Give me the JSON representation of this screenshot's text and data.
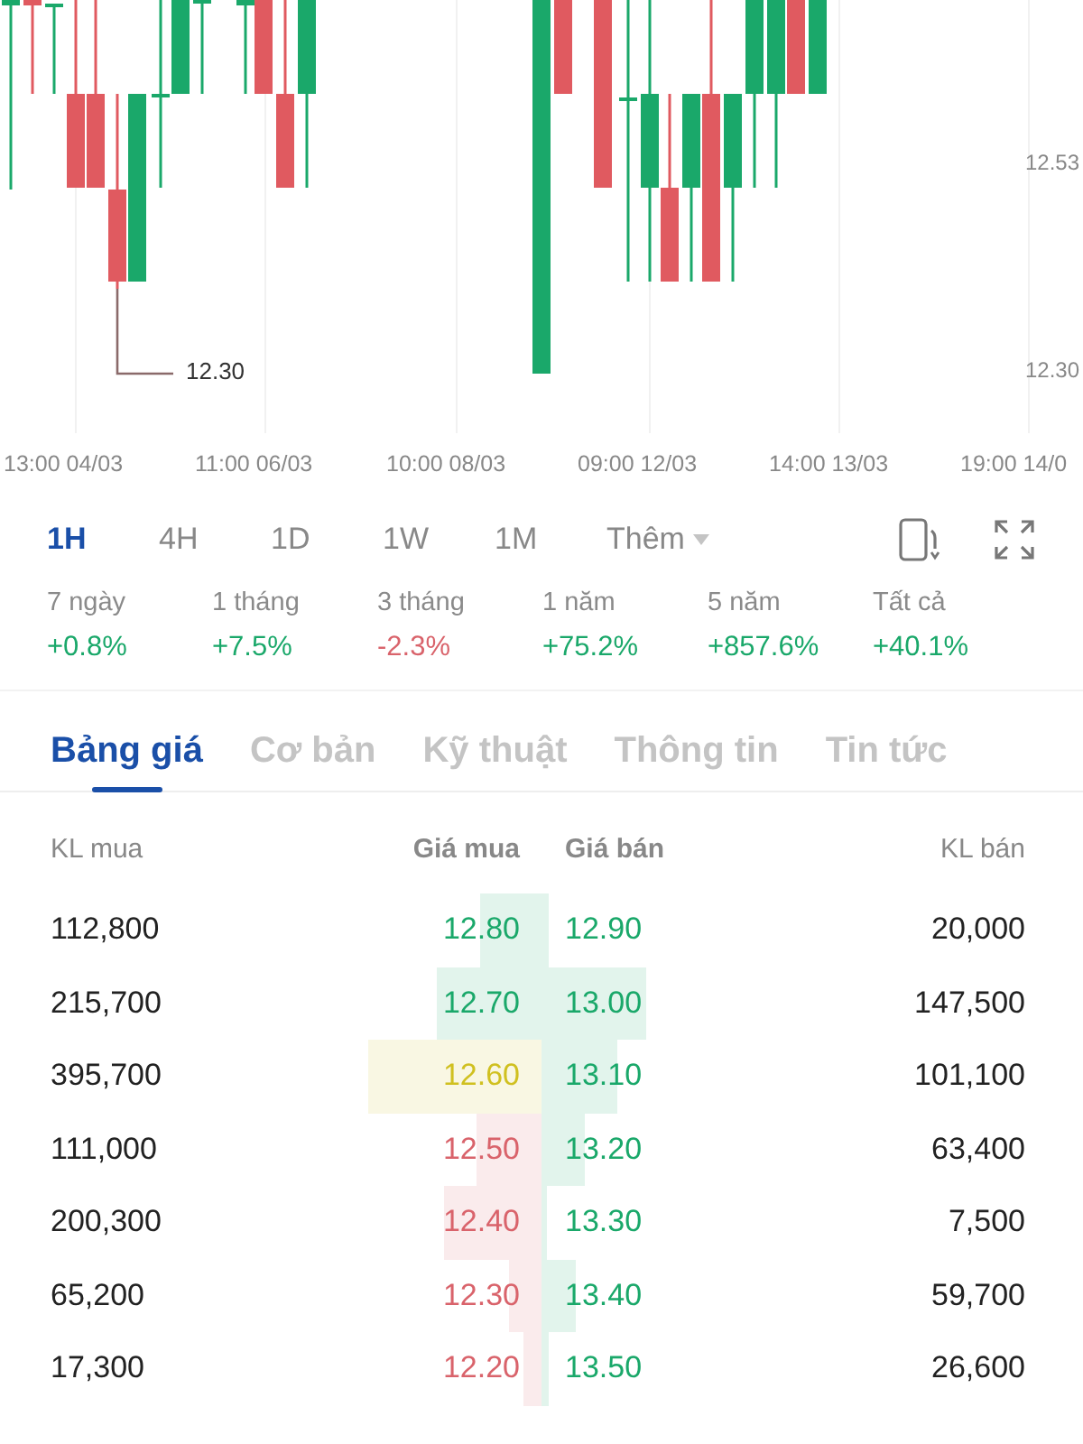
{
  "chart": {
    "y_labels": [
      "12.53",
      "12.30"
    ],
    "low_marker": "12.30",
    "x_labels": [
      "13:00 04/03",
      "11:00 06/03",
      "10:00 08/03",
      "09:00 12/03",
      "14:00 13/03",
      "19:00 14/0"
    ]
  },
  "timeframes": [
    {
      "label": "1H",
      "selected": true,
      "kind": "option"
    },
    {
      "label": "4H",
      "selected": false,
      "kind": "option"
    },
    {
      "label": "1D",
      "selected": false,
      "kind": "option"
    },
    {
      "label": "1W",
      "selected": false,
      "kind": "option"
    },
    {
      "label": "1M",
      "selected": false,
      "kind": "option"
    },
    {
      "label": "Thêm",
      "selected": false,
      "kind": "menu"
    }
  ],
  "performance": [
    {
      "label": "7 ngày",
      "value": "+0.8%",
      "color": "#1aa86a"
    },
    {
      "label": "1 tháng",
      "value": "+7.5%",
      "color": "#1aa86a"
    },
    {
      "label": "3 tháng",
      "value": "-2.3%",
      "color": "#d9636b"
    },
    {
      "label": "1 năm",
      "value": "+75.2%",
      "color": "#1aa86a"
    },
    {
      "label": "5 năm",
      "value": "+857.6%",
      "color": "#1aa86a"
    },
    {
      "label": "Tất cả",
      "value": "+40.1%",
      "color": "#1aa86a"
    }
  ],
  "tabs": [
    {
      "label": "Bảng giá",
      "selected": true
    },
    {
      "label": "Cơ bản",
      "selected": false
    },
    {
      "label": "Kỹ thuật",
      "selected": false
    },
    {
      "label": "Thông tin",
      "selected": false
    },
    {
      "label": "Tin tức",
      "selected": false
    }
  ],
  "order_book": {
    "columns": [
      "KL mua",
      "Giá mua",
      "Giá bán",
      "KL bán"
    ],
    "rows": [
      {
        "bid_volume": "112,800",
        "bid_price": {
          "text": "12.80",
          "color": "#1aa86a"
        },
        "ask_price": {
          "text": "12.90",
          "color": "#1aa86a"
        },
        "ask_volume": "20,000"
      },
      {
        "bid_volume": "215,700",
        "bid_price": {
          "text": "12.70",
          "color": "#1aa86a"
        },
        "ask_price": {
          "text": "13.00",
          "color": "#1aa86a"
        },
        "ask_volume": "147,500"
      },
      {
        "bid_volume": "395,700",
        "bid_price": {
          "text": "12.60",
          "color": "#d0c020"
        },
        "ask_price": {
          "text": "13.10",
          "color": "#1aa86a"
        },
        "ask_volume": "101,100"
      },
      {
        "bid_volume": "111,000",
        "bid_price": {
          "text": "12.50",
          "color": "#d9636b"
        },
        "ask_price": {
          "text": "13.20",
          "color": "#1aa86a"
        },
        "ask_volume": "63,400"
      },
      {
        "bid_volume": "200,300",
        "bid_price": {
          "text": "12.40",
          "color": "#d9636b"
        },
        "ask_price": {
          "text": "13.30",
          "color": "#1aa86a"
        },
        "ask_volume": "7,500"
      },
      {
        "bid_volume": "65,200",
        "bid_price": {
          "text": "12.30",
          "color": "#d9636b"
        },
        "ask_price": {
          "text": "13.40",
          "color": "#1aa86a"
        },
        "ask_volume": "59,700"
      },
      {
        "bid_volume": "17,300",
        "bid_price": {
          "text": "12.20",
          "color": "#d9636b"
        },
        "ask_price": {
          "text": "13.50",
          "color": "#1aa86a"
        },
        "ask_volume": "26,600"
      }
    ]
  }
}
